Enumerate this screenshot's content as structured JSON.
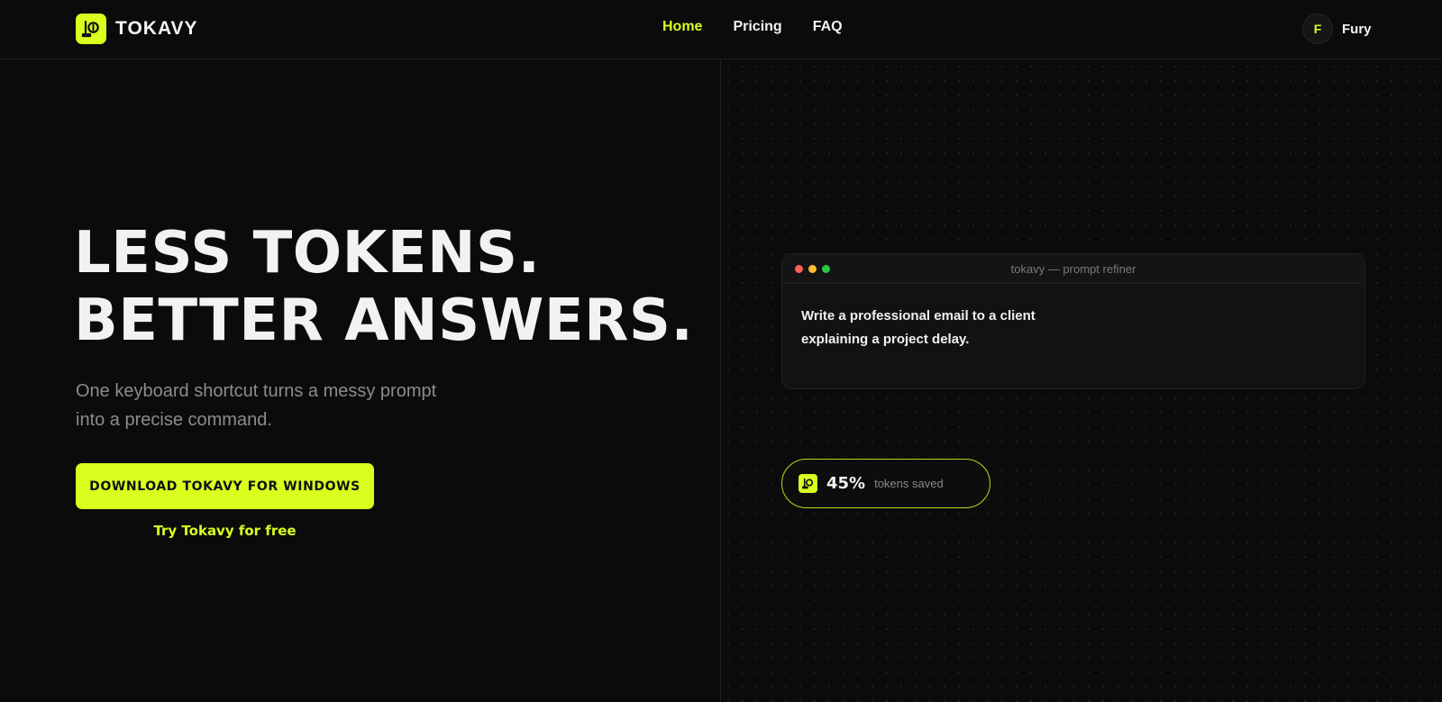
{
  "brand": {
    "name": "TOKAVY",
    "accent": "#d8ff1e",
    "logo_icon": "tokavy-logo-icon"
  },
  "nav": {
    "items": [
      {
        "label": "Home",
        "active": true
      },
      {
        "label": "Pricing",
        "active": false
      },
      {
        "label": "FAQ",
        "active": false
      }
    ]
  },
  "user": {
    "initial": "F",
    "name": "Fury"
  },
  "hero": {
    "headline_line1": "LESS TOKENS.",
    "headline_line2": "BETTER ANSWERS.",
    "subtitle": "One keyboard shortcut turns a messy prompt into a precise command.",
    "cta_label": "DOWNLOAD TOKAVY FOR WINDOWS",
    "secondary_link": "Try Tokavy for free"
  },
  "demo_window": {
    "title": "tokavy — prompt refiner",
    "prompt_text": "Write a professional email to a client explaining a project delay."
  },
  "savings": {
    "value": "45%",
    "label": "tokens saved"
  }
}
